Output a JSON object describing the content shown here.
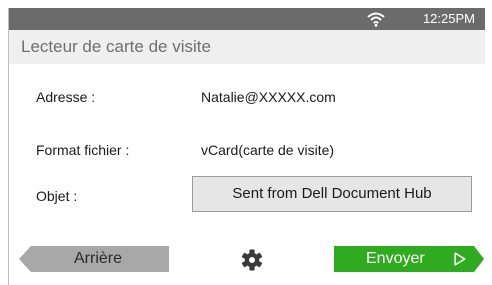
{
  "status_bar": {
    "time": "12:25PM",
    "wifi_icon": "wifi-icon"
  },
  "header": {
    "title": "Lecteur de carte de visite"
  },
  "fields": {
    "address_label": "Adresse :",
    "address_value": "Natalie@XXXXX.com",
    "format_label": "Format fichier :",
    "format_value": "vCard(carte de visite)",
    "subject_label": "Objet :",
    "subject_value": "Sent from Dell Document Hub"
  },
  "footer": {
    "back_label": "Arrière",
    "settings_icon": "gear-icon",
    "send_label": "Envoyer",
    "send_icon": "play-arrow-icon"
  },
  "colors": {
    "status_bar": "#6b6b6b",
    "send_button": "#2eab1e",
    "back_button": "#a8a8a8"
  }
}
